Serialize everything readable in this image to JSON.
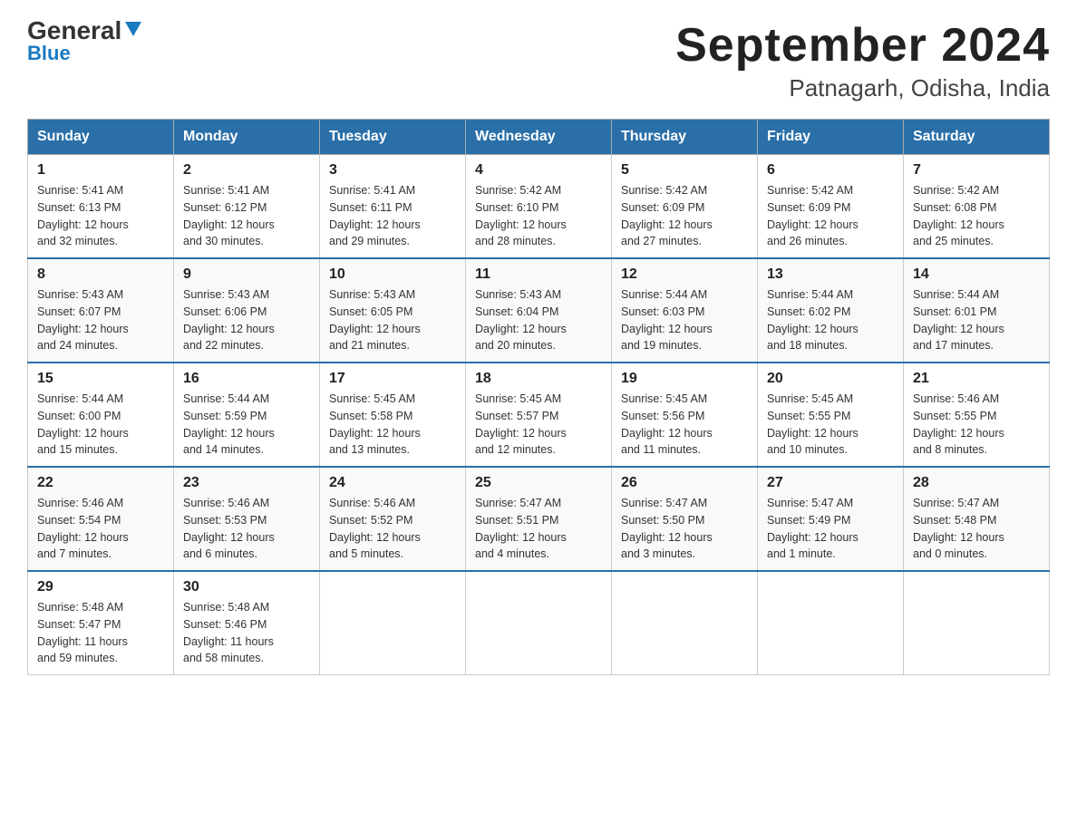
{
  "header": {
    "logo_general": "General",
    "logo_blue": "Blue",
    "title": "September 2024",
    "subtitle": "Patnagarh, Odisha, India"
  },
  "days_of_week": [
    "Sunday",
    "Monday",
    "Tuesday",
    "Wednesday",
    "Thursday",
    "Friday",
    "Saturday"
  ],
  "weeks": [
    [
      {
        "num": "1",
        "sunrise": "5:41 AM",
        "sunset": "6:13 PM",
        "daylight": "12 hours and 32 minutes."
      },
      {
        "num": "2",
        "sunrise": "5:41 AM",
        "sunset": "6:12 PM",
        "daylight": "12 hours and 30 minutes."
      },
      {
        "num": "3",
        "sunrise": "5:41 AM",
        "sunset": "6:11 PM",
        "daylight": "12 hours and 29 minutes."
      },
      {
        "num": "4",
        "sunrise": "5:42 AM",
        "sunset": "6:10 PM",
        "daylight": "12 hours and 28 minutes."
      },
      {
        "num": "5",
        "sunrise": "5:42 AM",
        "sunset": "6:09 PM",
        "daylight": "12 hours and 27 minutes."
      },
      {
        "num": "6",
        "sunrise": "5:42 AM",
        "sunset": "6:09 PM",
        "daylight": "12 hours and 26 minutes."
      },
      {
        "num": "7",
        "sunrise": "5:42 AM",
        "sunset": "6:08 PM",
        "daylight": "12 hours and 25 minutes."
      }
    ],
    [
      {
        "num": "8",
        "sunrise": "5:43 AM",
        "sunset": "6:07 PM",
        "daylight": "12 hours and 24 minutes."
      },
      {
        "num": "9",
        "sunrise": "5:43 AM",
        "sunset": "6:06 PM",
        "daylight": "12 hours and 22 minutes."
      },
      {
        "num": "10",
        "sunrise": "5:43 AM",
        "sunset": "6:05 PM",
        "daylight": "12 hours and 21 minutes."
      },
      {
        "num": "11",
        "sunrise": "5:43 AM",
        "sunset": "6:04 PM",
        "daylight": "12 hours and 20 minutes."
      },
      {
        "num": "12",
        "sunrise": "5:44 AM",
        "sunset": "6:03 PM",
        "daylight": "12 hours and 19 minutes."
      },
      {
        "num": "13",
        "sunrise": "5:44 AM",
        "sunset": "6:02 PM",
        "daylight": "12 hours and 18 minutes."
      },
      {
        "num": "14",
        "sunrise": "5:44 AM",
        "sunset": "6:01 PM",
        "daylight": "12 hours and 17 minutes."
      }
    ],
    [
      {
        "num": "15",
        "sunrise": "5:44 AM",
        "sunset": "6:00 PM",
        "daylight": "12 hours and 15 minutes."
      },
      {
        "num": "16",
        "sunrise": "5:44 AM",
        "sunset": "5:59 PM",
        "daylight": "12 hours and 14 minutes."
      },
      {
        "num": "17",
        "sunrise": "5:45 AM",
        "sunset": "5:58 PM",
        "daylight": "12 hours and 13 minutes."
      },
      {
        "num": "18",
        "sunrise": "5:45 AM",
        "sunset": "5:57 PM",
        "daylight": "12 hours and 12 minutes."
      },
      {
        "num": "19",
        "sunrise": "5:45 AM",
        "sunset": "5:56 PM",
        "daylight": "12 hours and 11 minutes."
      },
      {
        "num": "20",
        "sunrise": "5:45 AM",
        "sunset": "5:55 PM",
        "daylight": "12 hours and 10 minutes."
      },
      {
        "num": "21",
        "sunrise": "5:46 AM",
        "sunset": "5:55 PM",
        "daylight": "12 hours and 8 minutes."
      }
    ],
    [
      {
        "num": "22",
        "sunrise": "5:46 AM",
        "sunset": "5:54 PM",
        "daylight": "12 hours and 7 minutes."
      },
      {
        "num": "23",
        "sunrise": "5:46 AM",
        "sunset": "5:53 PM",
        "daylight": "12 hours and 6 minutes."
      },
      {
        "num": "24",
        "sunrise": "5:46 AM",
        "sunset": "5:52 PM",
        "daylight": "12 hours and 5 minutes."
      },
      {
        "num": "25",
        "sunrise": "5:47 AM",
        "sunset": "5:51 PM",
        "daylight": "12 hours and 4 minutes."
      },
      {
        "num": "26",
        "sunrise": "5:47 AM",
        "sunset": "5:50 PM",
        "daylight": "12 hours and 3 minutes."
      },
      {
        "num": "27",
        "sunrise": "5:47 AM",
        "sunset": "5:49 PM",
        "daylight": "12 hours and 1 minute."
      },
      {
        "num": "28",
        "sunrise": "5:47 AM",
        "sunset": "5:48 PM",
        "daylight": "12 hours and 0 minutes."
      }
    ],
    [
      {
        "num": "29",
        "sunrise": "5:48 AM",
        "sunset": "5:47 PM",
        "daylight": "11 hours and 59 minutes."
      },
      {
        "num": "30",
        "sunrise": "5:48 AM",
        "sunset": "5:46 PM",
        "daylight": "11 hours and 58 minutes."
      },
      null,
      null,
      null,
      null,
      null
    ]
  ],
  "labels": {
    "sunrise": "Sunrise: ",
    "sunset": "Sunset: ",
    "daylight": "Daylight: "
  }
}
